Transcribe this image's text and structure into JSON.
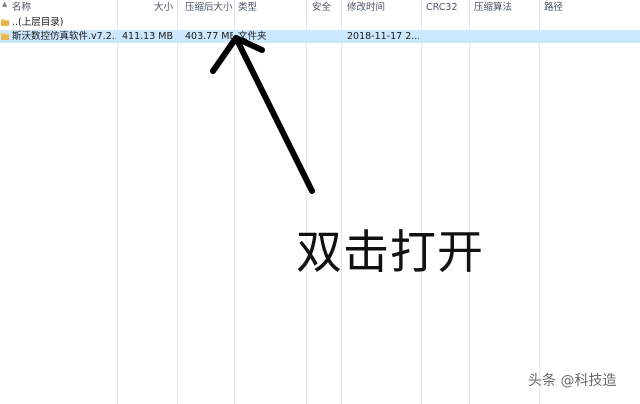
{
  "columns": {
    "name": "名称",
    "size": "大小",
    "packed_size": "压缩后大小",
    "type": "类型",
    "security": "安全",
    "modified": "修改时间",
    "crc32": "CRC32",
    "method": "压缩算法",
    "path": "路径"
  },
  "rows": [
    {
      "name": "..(上层目录)",
      "size": "",
      "packed_size": "",
      "type": "",
      "modified": ""
    },
    {
      "name": "斯沃数控仿真软件.v7.2....",
      "size": "411.13 MB",
      "packed_size": "403.77 MB",
      "type": "文件夹",
      "modified": "2018-11-17 2..."
    }
  ],
  "icons": {
    "sort": "sort-up-icon",
    "folder": "folder-icon"
  },
  "colors": {
    "selection": "#cce8ff",
    "folder": "#f4c95d",
    "arrow": "#000000"
  },
  "annotation": "双击打开",
  "watermark": "头条 @科技造"
}
